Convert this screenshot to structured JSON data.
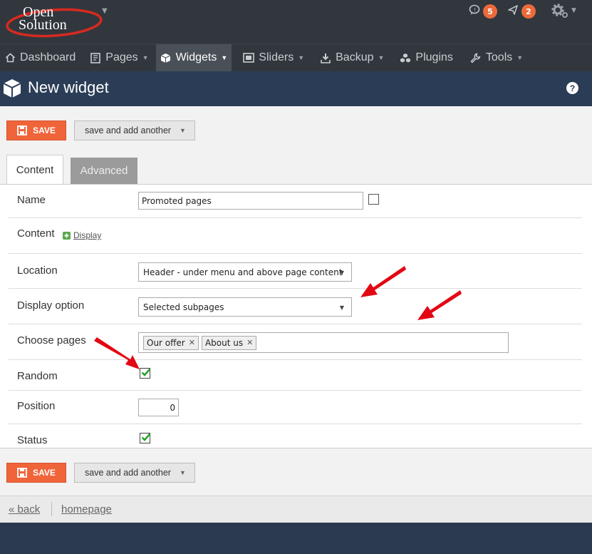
{
  "brand": {
    "line1": "Open",
    "line2": "Solution"
  },
  "notifications": {
    "comments_count": "5",
    "alerts_count": "2"
  },
  "nav": [
    {
      "label": "Dashboard",
      "icon": "home-icon",
      "dropdown": false
    },
    {
      "label": "Pages",
      "icon": "pages-icon",
      "dropdown": true
    },
    {
      "label": "Widgets",
      "icon": "cube-icon",
      "dropdown": true,
      "active": true
    },
    {
      "label": "Sliders",
      "icon": "sliders-icon",
      "dropdown": true
    },
    {
      "label": "Backup",
      "icon": "download-icon",
      "dropdown": true
    },
    {
      "label": "Plugins",
      "icon": "plugins-icon",
      "dropdown": false
    },
    {
      "label": "Tools",
      "icon": "wrench-icon",
      "dropdown": true
    }
  ],
  "header": {
    "title": "New widget",
    "help": "?"
  },
  "toolbar": {
    "save_label": "SAVE",
    "another_label": "save and add another"
  },
  "tabs": {
    "content": "Content",
    "advanced": "Advanced"
  },
  "form": {
    "name": {
      "label": "Name",
      "value": "Promoted pages"
    },
    "content": {
      "label": "Content",
      "link": "Display"
    },
    "location": {
      "label": "Location",
      "value": "Header - under menu and above page content"
    },
    "display_option": {
      "label": "Display option",
      "value": "Selected subpages"
    },
    "choose_pages": {
      "label": "Choose pages",
      "tags": [
        "Our offer",
        "About us"
      ]
    },
    "random": {
      "label": "Random",
      "checked": true
    },
    "position": {
      "label": "Position",
      "value": "0"
    },
    "status": {
      "label": "Status",
      "checked": true
    }
  },
  "footer": {
    "back": "« back",
    "homepage": "homepage"
  },
  "colors": {
    "save": "#f0643a",
    "arrow": "#e30613",
    "check": "#2aa12a"
  }
}
